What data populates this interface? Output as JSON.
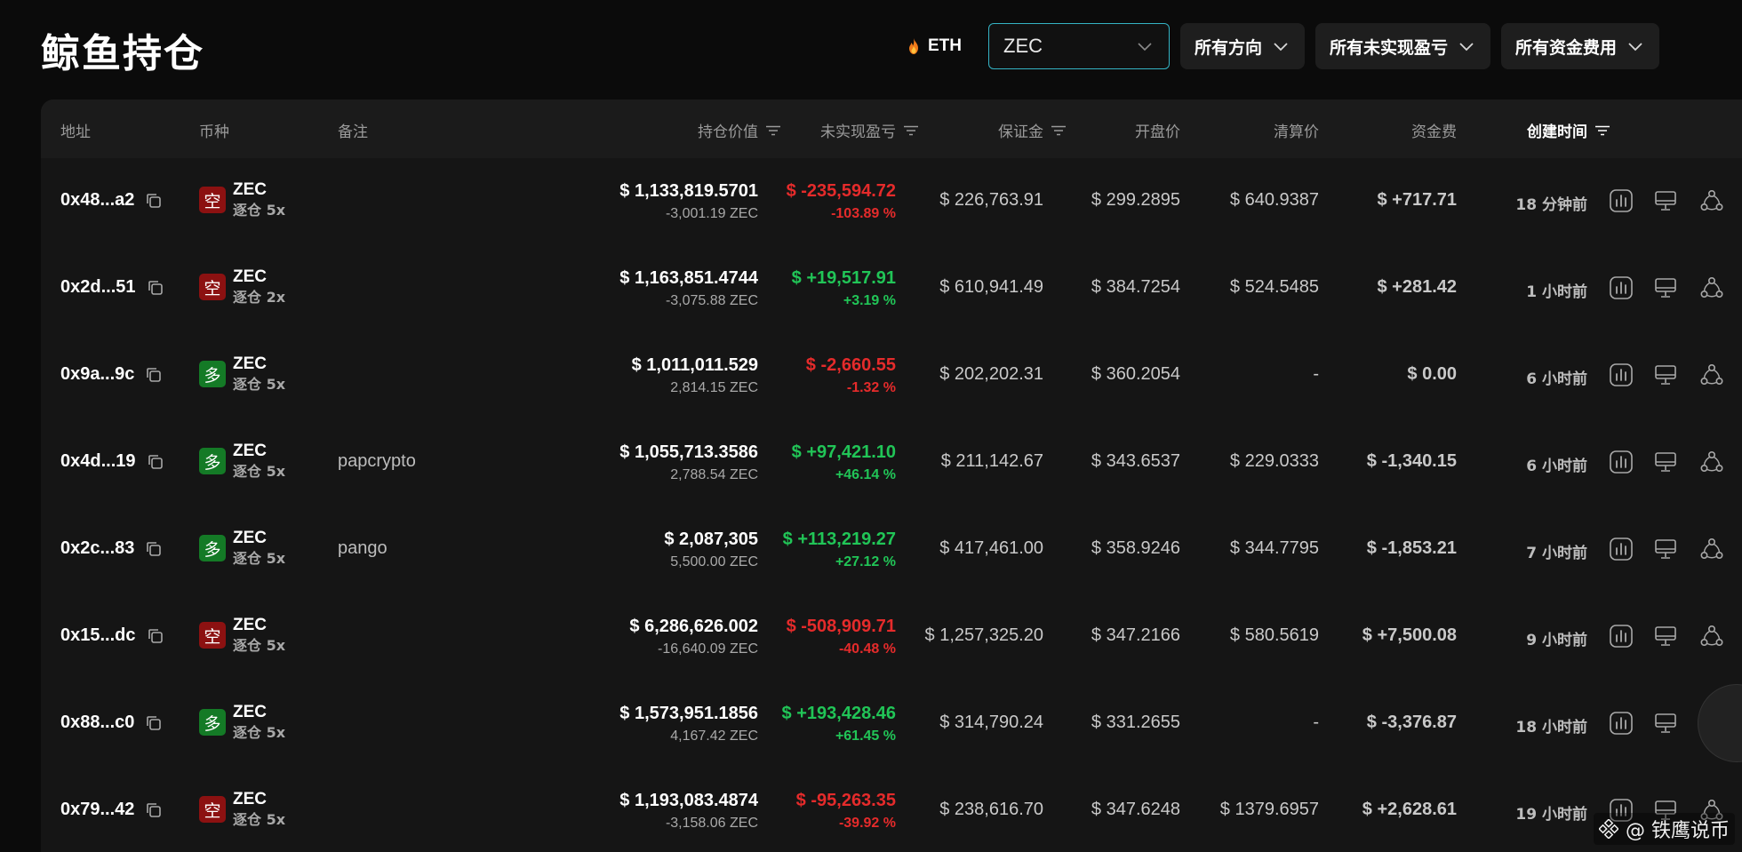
{
  "page": {
    "title": "鲸鱼持仓"
  },
  "filters": {
    "eth_label": "ETH",
    "coin_value": "ZEC",
    "direction": "所有方向",
    "pnl": "所有未实现盈亏",
    "funding": "所有资金费用"
  },
  "table": {
    "headers": {
      "address": "地址",
      "coin": "币种",
      "note": "备注",
      "value": "持仓价值",
      "pnl": "未实现盈亏",
      "margin": "保证金",
      "open": "开盘价",
      "liq": "清算价",
      "funding": "资金费",
      "created": "创建时间"
    },
    "rows": [
      {
        "address": "0x48...a2",
        "side": "空",
        "side_type": "short",
        "coin": "ZEC",
        "mode": "逐仓 5x",
        "note": "",
        "value": "$ 1,133,819.5701",
        "qty": "-3,001.19 ZEC",
        "pnl": "$ -235,594.72",
        "pnl_pct": "-103.89 %",
        "pnl_sign": "neg",
        "margin": "$ 226,763.91",
        "open": "$ 299.2895",
        "liq": "$ 640.9387",
        "funding": "$ +717.71",
        "funding_sign": "pos",
        "time": "18 分钟前"
      },
      {
        "address": "0x2d...51",
        "side": "空",
        "side_type": "short",
        "coin": "ZEC",
        "mode": "逐仓 2x",
        "note": "",
        "value": "$ 1,163,851.4744",
        "qty": "-3,075.88 ZEC",
        "pnl": "$ +19,517.91",
        "pnl_pct": "+3.19 %",
        "pnl_sign": "pos",
        "margin": "$ 610,941.49",
        "open": "$ 384.7254",
        "liq": "$ 524.5485",
        "funding": "$ +281.42",
        "funding_sign": "pos",
        "time": "1 小时前"
      },
      {
        "address": "0x9a...9c",
        "side": "多",
        "side_type": "long",
        "coin": "ZEC",
        "mode": "逐仓 5x",
        "note": "",
        "value": "$ 1,011,011.529",
        "qty": "2,814.15 ZEC",
        "pnl": "$ -2,660.55",
        "pnl_pct": "-1.32 %",
        "pnl_sign": "neg",
        "margin": "$ 202,202.31",
        "open": "$ 360.2054",
        "liq": "-",
        "funding": "$ 0.00",
        "funding_sign": "none",
        "time": "6 小时前"
      },
      {
        "address": "0x4d...19",
        "side": "多",
        "side_type": "long",
        "coin": "ZEC",
        "mode": "逐仓 5x",
        "note": "papcrypto",
        "value": "$ 1,055,713.3586",
        "qty": "2,788.54 ZEC",
        "pnl": "$ +97,421.10",
        "pnl_pct": "+46.14 %",
        "pnl_sign": "pos",
        "margin": "$ 211,142.67",
        "open": "$ 343.6537",
        "liq": "$ 229.0333",
        "funding": "$ -1,340.15",
        "funding_sign": "neg",
        "time": "6 小时前"
      },
      {
        "address": "0x2c...83",
        "side": "多",
        "side_type": "long",
        "coin": "ZEC",
        "mode": "逐仓 5x",
        "note": "pango",
        "value": "$ 2,087,305",
        "qty": "5,500.00 ZEC",
        "pnl": "$ +113,219.27",
        "pnl_pct": "+27.12 %",
        "pnl_sign": "pos",
        "margin": "$ 417,461.00",
        "open": "$ 358.9246",
        "liq": "$ 344.7795",
        "funding": "$ -1,853.21",
        "funding_sign": "neg",
        "time": "7 小时前"
      },
      {
        "address": "0x15...dc",
        "side": "空",
        "side_type": "short",
        "coin": "ZEC",
        "mode": "逐仓 5x",
        "note": "",
        "value": "$ 6,286,626.002",
        "qty": "-16,640.09 ZEC",
        "pnl": "$ -508,909.71",
        "pnl_pct": "-40.48 %",
        "pnl_sign": "neg",
        "margin": "$ 1,257,325.20",
        "open": "$ 347.2166",
        "liq": "$ 580.5619",
        "funding": "$ +7,500.08",
        "funding_sign": "pos",
        "time": "9 小时前"
      },
      {
        "address": "0x88...c0",
        "side": "多",
        "side_type": "long",
        "coin": "ZEC",
        "mode": "逐仓 5x",
        "note": "",
        "value": "$ 1,573,951.1856",
        "qty": "4,167.42 ZEC",
        "pnl": "$ +193,428.46",
        "pnl_pct": "+61.45 %",
        "pnl_sign": "pos",
        "margin": "$ 314,790.24",
        "open": "$ 331.2655",
        "liq": "-",
        "funding": "$ -3,376.87",
        "funding_sign": "neg",
        "time": "18 小时前"
      },
      {
        "address": "0x79...42",
        "side": "空",
        "side_type": "short",
        "coin": "ZEC",
        "mode": "逐仓 5x",
        "note": "",
        "value": "$ 1,193,083.4874",
        "qty": "-3,158.06 ZEC",
        "pnl": "$ -95,263.35",
        "pnl_pct": "-39.92 %",
        "pnl_sign": "neg",
        "margin": "$ 238,616.70",
        "open": "$ 347.6248",
        "liq": "$ 1379.6957",
        "funding": "$ +2,628.61",
        "funding_sign": "pos",
        "time": "19 小时前"
      }
    ]
  },
  "watermark": "@ 铁鹰说币",
  "colors": {
    "positive": "#21c557",
    "negative": "#e52b2b",
    "short_badge": "#8c1111",
    "long_badge": "#147a26",
    "select_border": "#34b3c4"
  },
  "icons": {
    "flame": "flame-icon",
    "chevron": "chevron-down-icon",
    "sort": "filter-sort-icon",
    "copy": "copy-icon",
    "chart": "chart-icon",
    "monitor": "monitor-icon",
    "share": "share-icon"
  }
}
